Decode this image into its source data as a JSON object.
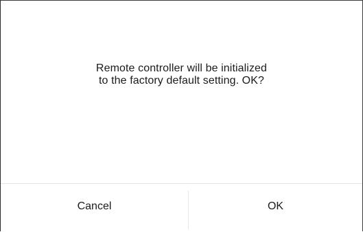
{
  "dialog": {
    "message_lines": [
      "Remote controller will be initialized",
      "to the factory default setting. OK?"
    ],
    "buttons": {
      "cancel_label": "Cancel",
      "ok_label": "OK"
    }
  }
}
